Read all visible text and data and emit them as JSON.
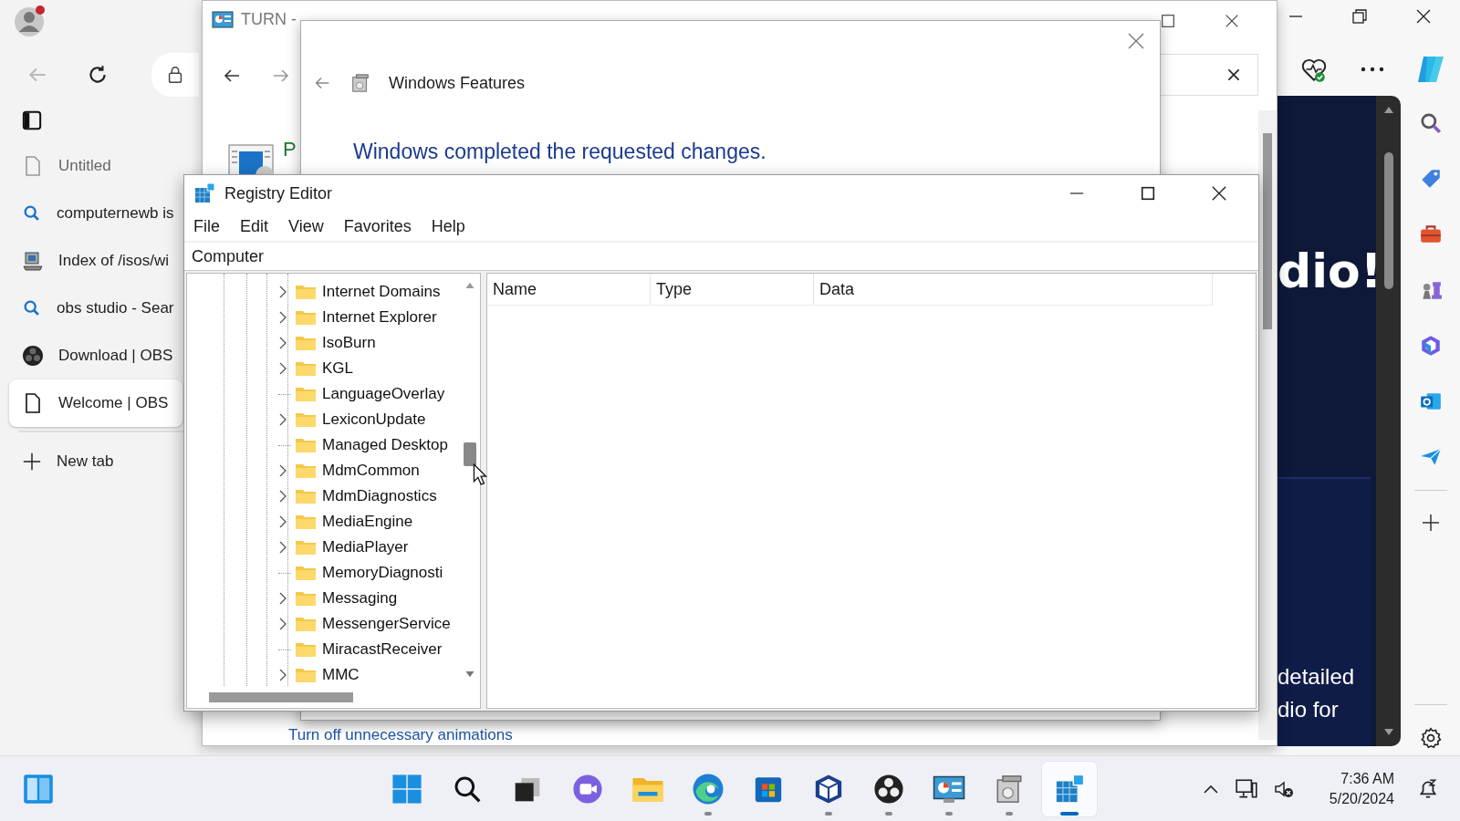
{
  "browser": {
    "tabs": [
      {
        "kind": "page",
        "title": "Untitled",
        "selected": false
      },
      {
        "kind": "search",
        "title": "computernewb is",
        "selected": false
      },
      {
        "kind": "server",
        "title": "Index of /isos/wi",
        "selected": false
      },
      {
        "kind": "search",
        "title": "obs studio - Sear",
        "selected": false
      },
      {
        "kind": "obs",
        "title": "Download | OBS",
        "selected": false
      },
      {
        "kind": "page",
        "title": "Welcome | OBS",
        "selected": true
      }
    ],
    "new_tab": "New tab"
  },
  "web_page": {
    "heading": "dio!",
    "lines": [
      "detailed",
      "dio for"
    ]
  },
  "control_panel": {
    "title": "TURN -",
    "item_letter": "P",
    "link": "Turn off unnecessary animations"
  },
  "windows_features": {
    "title": "Windows Features",
    "message": "Windows completed the requested changes."
  },
  "registry_editor": {
    "title": "Registry Editor",
    "menu": [
      "File",
      "Edit",
      "View",
      "Favorites",
      "Help"
    ],
    "address": "Computer",
    "tree": [
      {
        "label": "Internet Domains",
        "expandable": true
      },
      {
        "label": "Internet Explorer",
        "expandable": true
      },
      {
        "label": "IsoBurn",
        "expandable": true
      },
      {
        "label": "KGL",
        "expandable": true
      },
      {
        "label": "LanguageOverlay",
        "expandable": false
      },
      {
        "label": "LexiconUpdate",
        "expandable": true
      },
      {
        "label": "Managed Desktop",
        "expandable": false
      },
      {
        "label": "MdmCommon",
        "expandable": true
      },
      {
        "label": "MdmDiagnostics",
        "expandable": true
      },
      {
        "label": "MediaEngine",
        "expandable": true
      },
      {
        "label": "MediaPlayer",
        "expandable": true
      },
      {
        "label": "MemoryDiagnosti",
        "expandable": false
      },
      {
        "label": "Messaging",
        "expandable": true
      },
      {
        "label": "MessengerService",
        "expandable": true
      },
      {
        "label": "MiracastReceiver",
        "expandable": false
      },
      {
        "label": "MMC",
        "expandable": true
      }
    ],
    "columns": [
      "Name",
      "Type",
      "Data"
    ]
  },
  "taskbar": {
    "apps": [
      {
        "kind": "start",
        "running": false,
        "selected": false
      },
      {
        "kind": "search",
        "running": false,
        "selected": false
      },
      {
        "kind": "taskview",
        "running": false,
        "selected": false
      },
      {
        "kind": "chat",
        "running": false,
        "selected": false
      },
      {
        "kind": "explorer",
        "running": false,
        "selected": false
      },
      {
        "kind": "edge",
        "running": true,
        "selected": false
      },
      {
        "kind": "store",
        "running": false,
        "selected": false
      },
      {
        "kind": "vbox",
        "running": true,
        "selected": false
      },
      {
        "kind": "obs",
        "running": true,
        "selected": false
      },
      {
        "kind": "cpanel",
        "running": true,
        "selected": false
      },
      {
        "kind": "features",
        "running": true,
        "selected": false
      },
      {
        "kind": "regedit",
        "running": true,
        "selected": true
      }
    ],
    "time": "7:36 AM",
    "date": "5/20/2024"
  }
}
